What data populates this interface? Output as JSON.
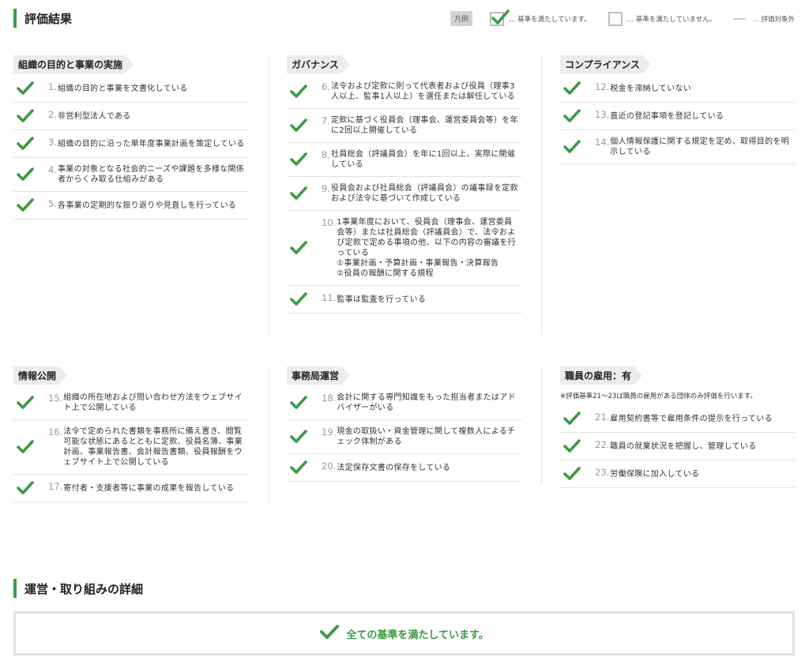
{
  "header": {
    "title": "評価結果"
  },
  "legend": {
    "label": "凡例",
    "met": "… 基準を満たしています。",
    "not_met": "… 基準を満たしていません。",
    "excluded": "… 評価対象外"
  },
  "colors": {
    "accent": "#3c9a44",
    "divider": "#e2e2e2"
  },
  "groups": [
    {
      "title": "組織の目的と事業の実施",
      "note": "",
      "items": [
        {
          "num": "1.",
          "text": "組織の目的と事業を文書化している",
          "met": true
        },
        {
          "num": "2.",
          "text": "非営利型法人である",
          "met": true
        },
        {
          "num": "3.",
          "text": "組織の目的に沿った単年度事業計画を策定している",
          "met": true
        },
        {
          "num": "4.",
          "text": "事業の対象となる社会的ニーズや課題を多様な関係者からくみ取る仕組みがある",
          "met": true
        },
        {
          "num": "5.",
          "text": "各事業の定期的な振り返りや見直しを行っている",
          "met": true
        }
      ]
    },
    {
      "title": "ガバナンス",
      "note": "",
      "items": [
        {
          "num": "6.",
          "text": "法令および定款に則って代表者および役員（理事3人以上、監事1人以上）を選任または解任している",
          "met": true
        },
        {
          "num": "7.",
          "text": "定款に基づく役員会（理事会、運営委員会等）を年に2回以上開催している",
          "met": true
        },
        {
          "num": "8.",
          "text": "社員総会（評議員会）を年に1回以上、実際に開催している",
          "met": true
        },
        {
          "num": "9.",
          "text": "役員会および社員総会（評議員会）の議事録を定款および法令に基づいて作成している",
          "met": true
        },
        {
          "num": "10.",
          "text": "1事業年度において、役員会（理事会、運営委員会等）または社員総会（評議員会）で、法令および定款で定める事項の他、以下の内容の審議を行っている\n①事業計画・予算計画・事業報告・決算報告\n②役員の報酬に関する規程",
          "met": true
        },
        {
          "num": "11.",
          "text": "監事は監査を行っている",
          "met": true
        }
      ]
    },
    {
      "title": "コンプライアンス",
      "note": "",
      "items": [
        {
          "num": "12.",
          "text": "税金を滞納していない",
          "met": true
        },
        {
          "num": "13.",
          "text": "直近の登記事項を登記している",
          "met": true
        },
        {
          "num": "14.",
          "text": "個人情報保護に関する規定を定め、取得目的を明示している",
          "met": true
        }
      ]
    },
    {
      "title": "情報公開",
      "note": "",
      "items": [
        {
          "num": "15.",
          "text": "組織の所在地および問い合わせ方法をウェブサイト上で公開している",
          "met": true
        },
        {
          "num": "16.",
          "text": "法令で定められた書類を事務所に備え置き、閲覧可能な状態にあるとともに定款、役員名簿、事業計画、事業報告書、会計報告書類、役員報酬をウェブサイト上で公開している",
          "met": true
        },
        {
          "num": "17.",
          "text": "寄付者・支援者等に事業の成果を報告している",
          "met": true
        }
      ]
    },
    {
      "title": "事務局運営",
      "note": "",
      "items": [
        {
          "num": "18.",
          "text": "会計に関する専門知識をもった担当者またはアドバイザーがいる",
          "met": true
        },
        {
          "num": "19.",
          "text": "現金の取扱い・資金管理に関して複数人によるチェック体制がある",
          "met": true
        },
        {
          "num": "20.",
          "text": "法定保存文書の保存をしている",
          "met": true
        }
      ]
    },
    {
      "title": "職員の雇用：有",
      "note": "※評価基準21〜23は職員の雇用がある団体のみ評価を行います。",
      "items": [
        {
          "num": "21.",
          "text": "雇用契約書等で雇用条件の提示を行っている",
          "met": true
        },
        {
          "num": "22.",
          "text": "職員の就業状況を把握し、管理している",
          "met": true
        },
        {
          "num": "23.",
          "text": "労働保険に加入している",
          "met": true
        }
      ]
    }
  ],
  "details": {
    "title": "運営・取り組みの詳細",
    "summary": "全ての基準を満たしています。"
  }
}
